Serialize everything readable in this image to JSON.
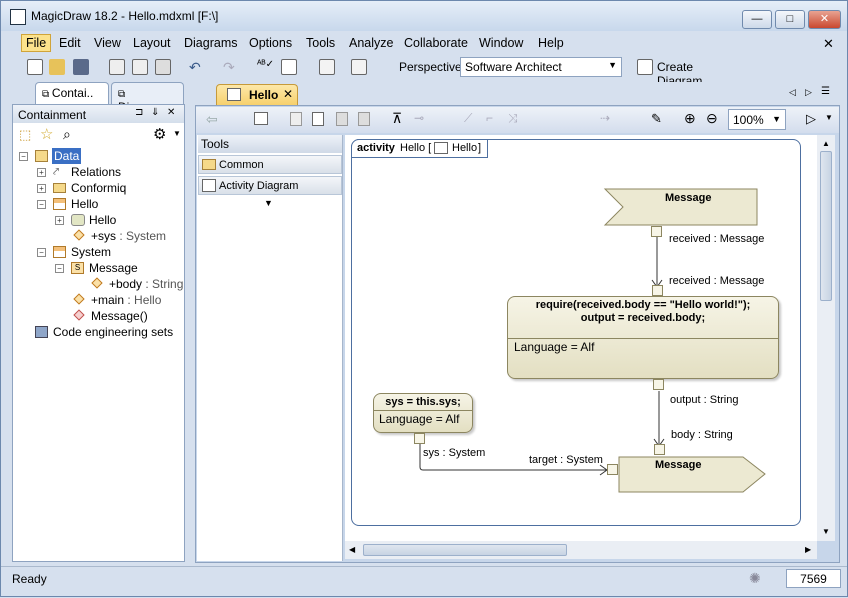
{
  "window": {
    "title": "MagicDraw 18.2 - Hello.mdxml [F:\\]",
    "minimize": "—",
    "maximize": "□",
    "close": "✕"
  },
  "menu": [
    "File",
    "Edit",
    "View",
    "Layout",
    "Diagrams",
    "Options",
    "Tools",
    "Analyze",
    "Collaborate",
    "Window",
    "Help"
  ],
  "menu_close": "✕",
  "toolbar": {
    "perspective_label": "Perspective:",
    "perspective_value": "Software Architect",
    "create_diagram": "Create Diagram"
  },
  "left_tabs": {
    "containment": "Contai..",
    "diagrams": "Diagrams"
  },
  "containment": {
    "title": "Containment",
    "pin": "⊐",
    "pin2": "⇓",
    "close": "✕"
  },
  "tree": [
    {
      "label": "Data",
      "type": ""
    },
    {
      "label": "Relations",
      "type": ""
    },
    {
      "label": "Conformiq",
      "type": ""
    },
    {
      "label": "Hello",
      "type": ""
    },
    {
      "label": "Hello",
      "type": ""
    },
    {
      "label": "+sys",
      "type": " : System"
    },
    {
      "label": "System",
      "type": ""
    },
    {
      "label": "Message",
      "type": ""
    },
    {
      "label": "+body",
      "type": " : String"
    },
    {
      "label": "+main",
      "type": " : Hello"
    },
    {
      "label": "Message()",
      "type": ""
    },
    {
      "label": "Code engineering sets",
      "type": ""
    }
  ],
  "editor_tab": "Hello",
  "zoom": "100%",
  "tools": {
    "title": "Tools",
    "common": "Common",
    "activity": "Activity Diagram"
  },
  "diagram": {
    "frame_kind": "activity",
    "frame_name": "Hello [",
    "frame_ref": "Hello",
    "frame_close": "]",
    "msg_top": "Message",
    "received_out": "received : Message",
    "received_in": "received : Message",
    "action_code_line1": "require(received.body == \"Hello world!\");",
    "action_code_line2": "output = received.body;",
    "action_lang": "Language = Alf",
    "output_pin": "output : String",
    "body_pin": "body : String",
    "sys_code": "sys = this.sys;",
    "sys_lang": "Language = Alf",
    "sys_pin": "sys : System",
    "target_pin": "target : System",
    "msg_bottom": "Message"
  },
  "status": {
    "text": "Ready",
    "count": "7569"
  },
  "colors": {
    "accent": "#fce28c",
    "frame": "#4d6fa0",
    "node": "#ece9d2"
  }
}
